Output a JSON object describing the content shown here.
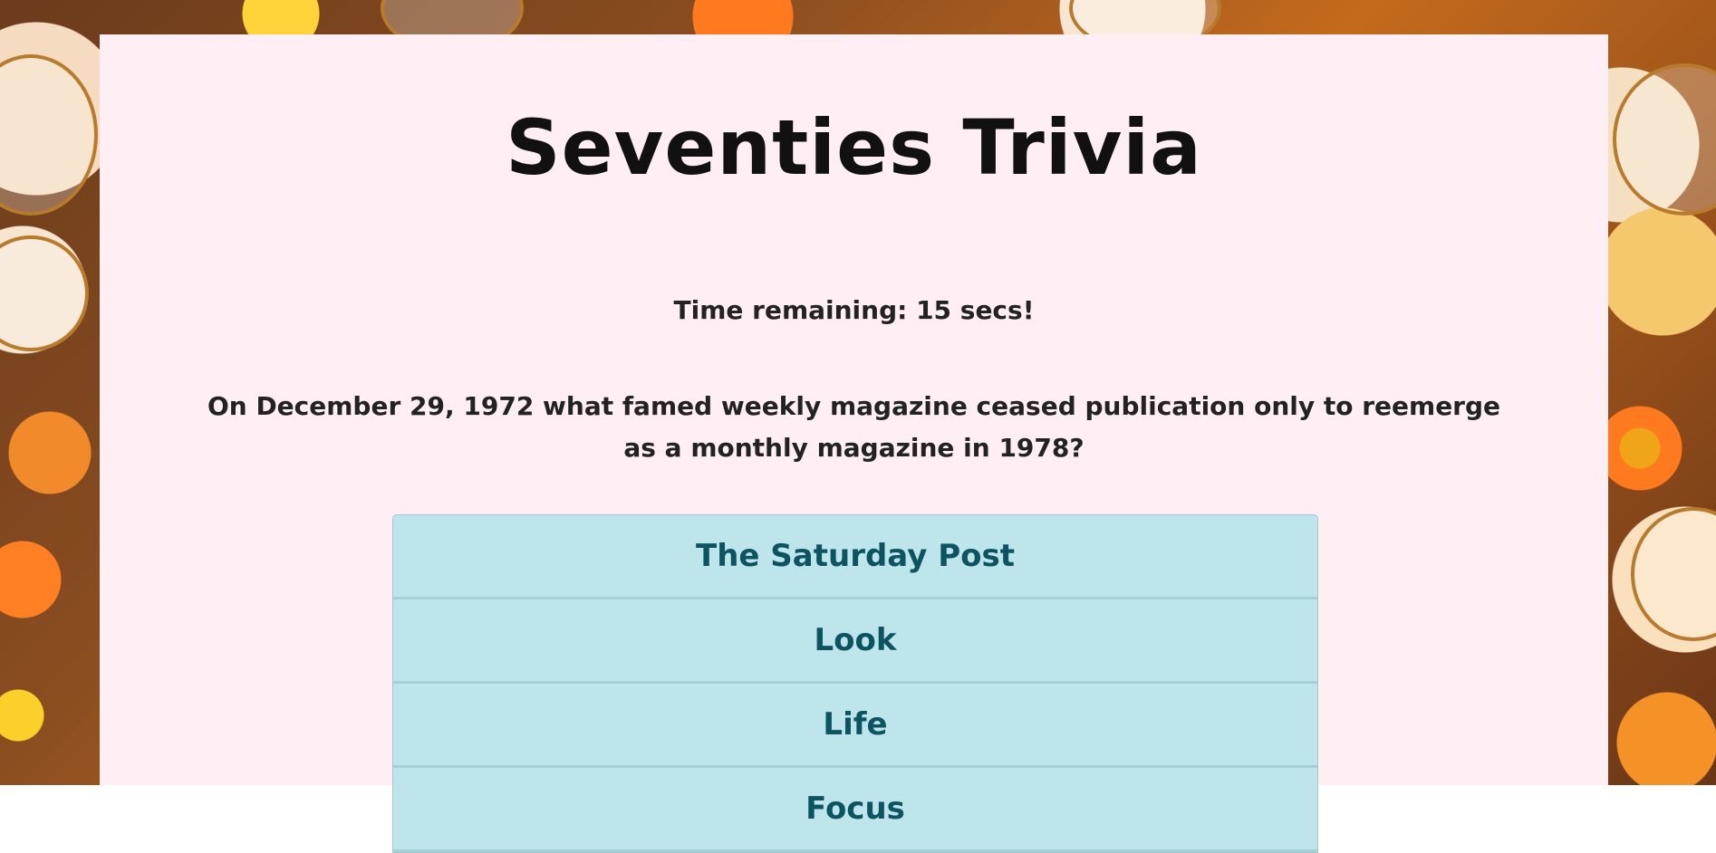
{
  "page": {
    "title": "Seventies Trivia",
    "timer_text": "Time remaining: 15 secs!",
    "question": "On December 29, 1972 what famed weekly magazine ceased publication only to reemerge as a monthly magazine in 1978?"
  },
  "answers": [
    {
      "label": "The Saturday Post"
    },
    {
      "label": "Look"
    },
    {
      "label": "Life"
    },
    {
      "label": "Focus"
    }
  ],
  "colors": {
    "card_background": "#ffeef3",
    "answer_background": "#bee5eb",
    "answer_text": "#0c5460",
    "answer_border": "#a6cfd6"
  }
}
